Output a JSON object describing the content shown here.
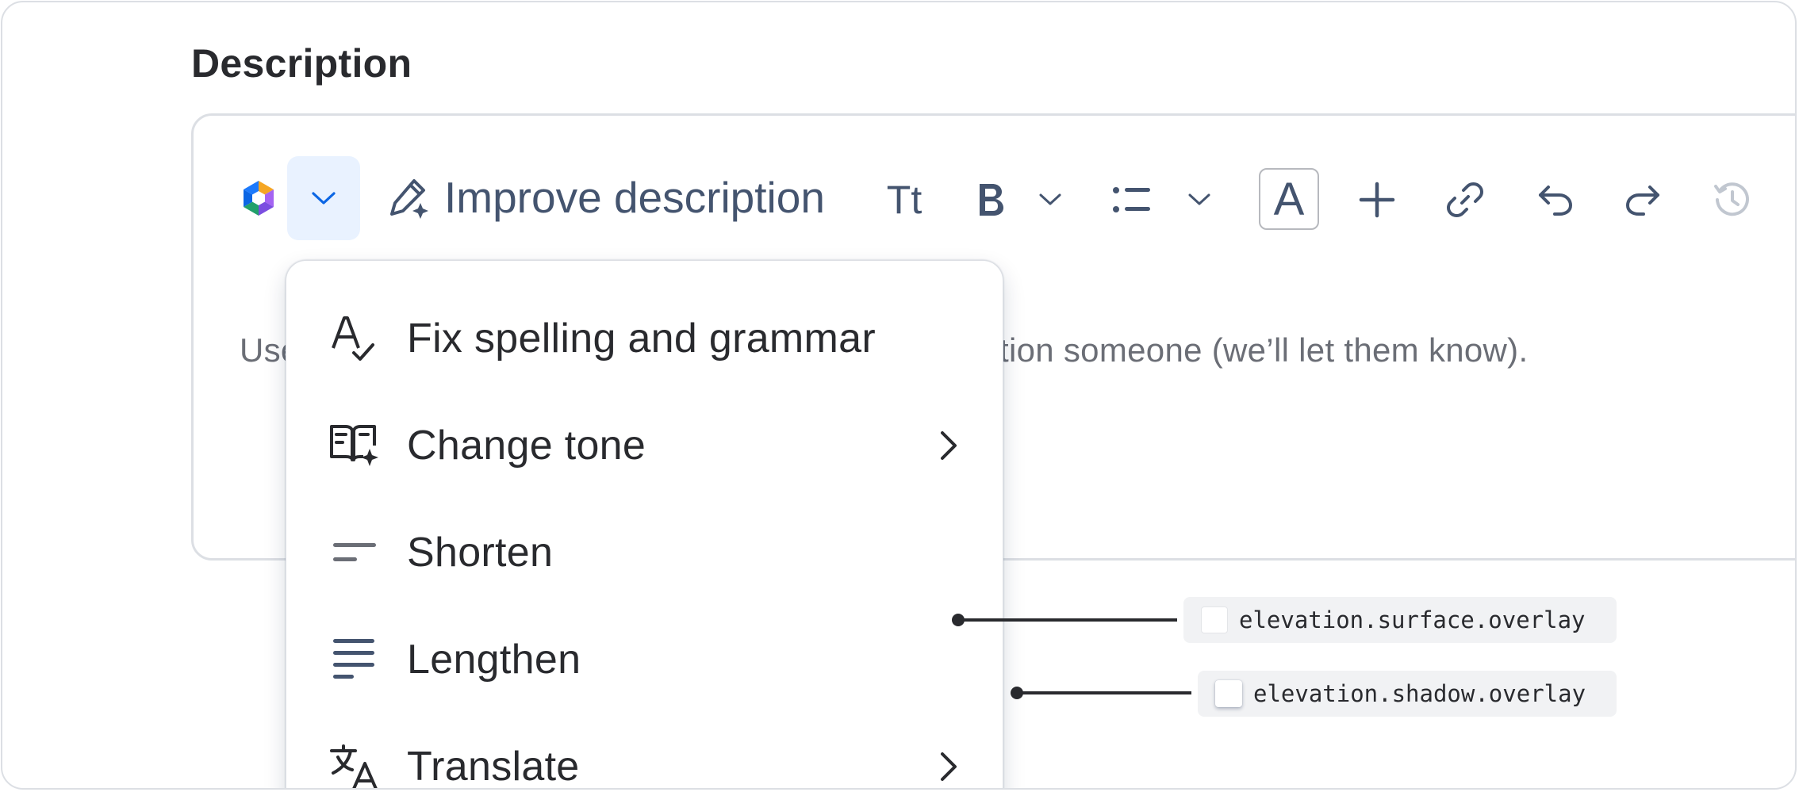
{
  "section": {
    "title": "Description"
  },
  "toolbar": {
    "logo_icon": "atlassian-ai-logo-icon",
    "ai_menu_icon": "chevron-down-icon",
    "improve_label": "Improve description",
    "text_style_label": "Tt",
    "bold_label": "B",
    "text_color_label": "A",
    "icons": [
      "pencil-sparkle-icon",
      "bold-icon",
      "bullet-list-icon",
      "plus-icon",
      "link-icon",
      "undo-icon",
      "redo-icon",
      "history-icon"
    ],
    "accent_color": "#0c66e4",
    "selected_bg": "#e9f2ff"
  },
  "editor": {
    "placeholder_left": "Use",
    "placeholder_right": "tion someone (we’ll let them know)."
  },
  "menu": {
    "items": [
      {
        "label": "Fix spelling and grammar",
        "icon": "spellcheck-icon",
        "has_submenu": false
      },
      {
        "label": "Change tone",
        "icon": "book-sparkle-icon",
        "has_submenu": true
      },
      {
        "label": "Shorten",
        "icon": "shorten-lines-icon",
        "has_submenu": false
      },
      {
        "label": "Lengthen",
        "icon": "lengthen-lines-icon",
        "has_submenu": false
      },
      {
        "label": "Translate",
        "icon": "translate-icon",
        "has_submenu": true
      }
    ]
  },
  "annotations": {
    "surface": "elevation.surface.overlay",
    "shadow": "elevation.shadow.overlay"
  }
}
